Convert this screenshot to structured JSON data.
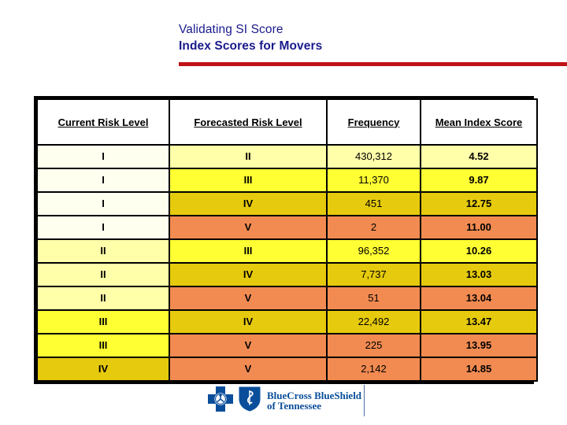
{
  "slide": {
    "title_line_1": "Validating SI Score",
    "title_line_2": "Index Scores for Movers",
    "title_color": "#1a1a8c",
    "rule_color": "#c1121a"
  },
  "table": {
    "columns": [
      {
        "key": "current_risk_level",
        "label": "Current Risk Level"
      },
      {
        "key": "forecasted_risk_level",
        "label": "Forecasted Risk Level"
      },
      {
        "key": "frequency",
        "label": "Frequency"
      },
      {
        "key": "mean_index_score",
        "label": "Mean Index Score"
      }
    ],
    "level_colors": {
      "I": "#ffffef",
      "II": "#ffffaa",
      "III": "#ffff33",
      "IV": "#e6ca0d",
      "V": "#f28b51"
    },
    "rows": [
      {
        "current_risk_level": "I",
        "forecasted_risk_level": "II",
        "frequency": "430,312",
        "mean_index_score": "4.52"
      },
      {
        "current_risk_level": "I",
        "forecasted_risk_level": "III",
        "frequency": "11,370",
        "mean_index_score": "9.87"
      },
      {
        "current_risk_level": "I",
        "forecasted_risk_level": "IV",
        "frequency": "451",
        "mean_index_score": "12.75"
      },
      {
        "current_risk_level": "I",
        "forecasted_risk_level": "V",
        "frequency": "2",
        "mean_index_score": "11.00"
      },
      {
        "current_risk_level": "II",
        "forecasted_risk_level": "III",
        "frequency": "96,352",
        "mean_index_score": "10.26"
      },
      {
        "current_risk_level": "II",
        "forecasted_risk_level": "IV",
        "frequency": "7,737",
        "mean_index_score": "13.03"
      },
      {
        "current_risk_level": "II",
        "forecasted_risk_level": "V",
        "frequency": "51",
        "mean_index_score": "13.04"
      },
      {
        "current_risk_level": "III",
        "forecasted_risk_level": "IV",
        "frequency": "22,492",
        "mean_index_score": "13.47"
      },
      {
        "current_risk_level": "III",
        "forecasted_risk_level": "V",
        "frequency": "225",
        "mean_index_score": "13.95"
      },
      {
        "current_risk_level": "IV",
        "forecasted_risk_level": "V",
        "frequency": "2,142",
        "mean_index_score": "14.85"
      }
    ]
  },
  "logo": {
    "text_line_1": "BlueCross BlueShield",
    "text_line_2": "of Tennessee",
    "brand_color": "#0a4e9b",
    "cross_icon": "blue-cross-icon",
    "shield_icon": "blue-shield-icon"
  }
}
